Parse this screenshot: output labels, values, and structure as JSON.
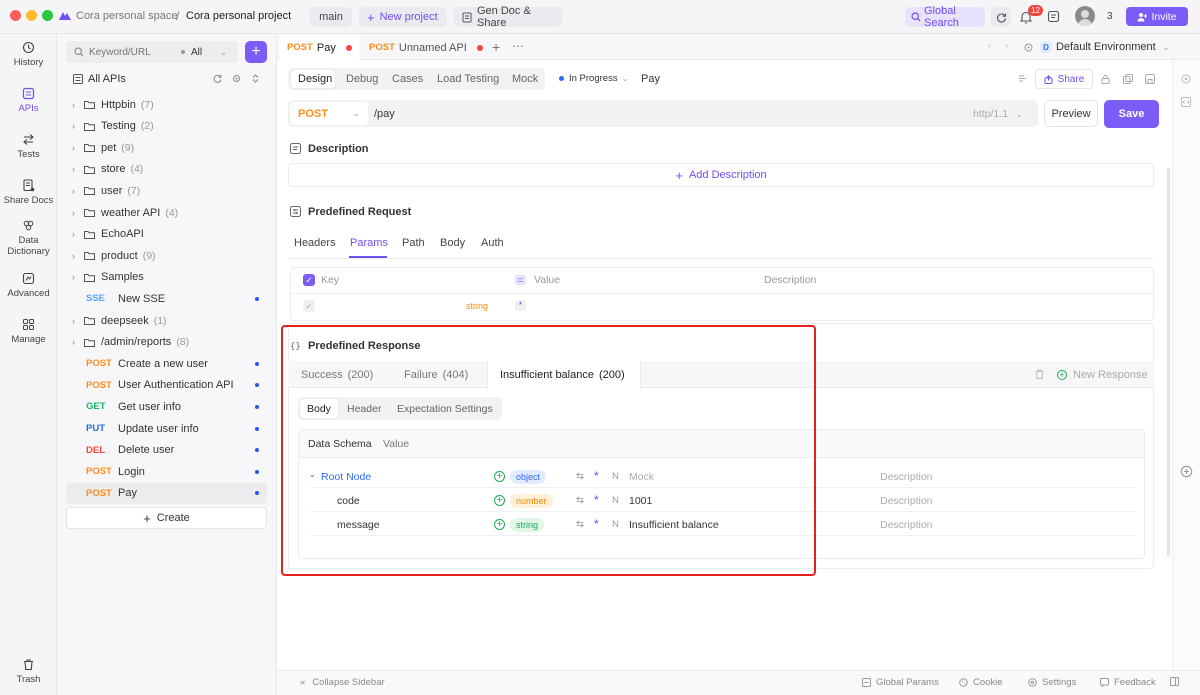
{
  "titlebar": {
    "space": "Cora personal space",
    "separator": "/",
    "project": "Cora personal project",
    "branch": "main",
    "new_project": "New project",
    "gen_doc": "Gen Doc & Share",
    "global_search": "Global Search",
    "notif_count": "12",
    "members_count": "3",
    "invite": "Invite"
  },
  "leftnav": [
    {
      "label": "History",
      "icon": "history-icon"
    },
    {
      "label": "APIs",
      "icon": "apis-icon"
    },
    {
      "label": "Tests",
      "icon": "tests-icon"
    },
    {
      "label": "Share Docs",
      "icon": "share-docs-icon"
    },
    {
      "label": "Data Dictionary",
      "icon": "data-dictionary-icon"
    },
    {
      "label": "Advanced",
      "icon": "advanced-icon"
    },
    {
      "label": "Manage",
      "icon": "manage-icon"
    },
    {
      "label": "Trash",
      "icon": "trash-icon"
    }
  ],
  "sidebar": {
    "search_placeholder": "Keyword/URL",
    "filter": "All",
    "all_apis": "All APIs",
    "items": [
      {
        "kind": "folder",
        "label": "Httpbin",
        "count": "(7)"
      },
      {
        "kind": "folder",
        "label": "Testing",
        "count": "(2)"
      },
      {
        "kind": "folder",
        "label": "pet",
        "count": "(9)"
      },
      {
        "kind": "folder",
        "label": "store",
        "count": "(4)"
      },
      {
        "kind": "folder",
        "label": "user",
        "count": "(7)"
      },
      {
        "kind": "folder",
        "label": "weather API",
        "count": "(4)"
      },
      {
        "kind": "folder",
        "label": "EchoAPI",
        "count": ""
      },
      {
        "kind": "folder",
        "label": "product",
        "count": "(9)"
      },
      {
        "kind": "folder",
        "label": "Samples",
        "count": ""
      },
      {
        "kind": "api",
        "method": "SSE",
        "label": "New SSE"
      },
      {
        "kind": "folder",
        "label": "deepseek",
        "count": "(1)"
      },
      {
        "kind": "folder",
        "label": "/admin/reports",
        "count": "(8)"
      },
      {
        "kind": "api",
        "method": "POST",
        "label": "Create a new user"
      },
      {
        "kind": "api",
        "method": "POST",
        "label": "User Authentication API"
      },
      {
        "kind": "api",
        "method": "GET",
        "label": "Get user info"
      },
      {
        "kind": "api",
        "method": "PUT",
        "label": "Update user info"
      },
      {
        "kind": "api",
        "method": "DEL",
        "label": "Delete user"
      },
      {
        "kind": "api",
        "method": "POST",
        "label": "Login"
      },
      {
        "kind": "api",
        "method": "POST",
        "label": "Pay"
      }
    ],
    "create": "Create"
  },
  "tabs": [
    {
      "method": "POST",
      "name": "Pay"
    },
    {
      "method": "POST",
      "name": "Unnamed API"
    }
  ],
  "environment": {
    "badge": "D",
    "name": "Default Environment"
  },
  "subtabs": [
    "Design",
    "Debug",
    "Cases",
    "Load Testing",
    "Mock"
  ],
  "status": "In Progress",
  "api_name": "Pay",
  "share": "Share",
  "request": {
    "method": "POST",
    "url": "/pay",
    "protocol": "http/1.1",
    "preview": "Preview",
    "save": "Save"
  },
  "description": {
    "title": "Description",
    "add": "Add Description"
  },
  "predefined_request": {
    "title": "Predefined Request",
    "tabs": [
      "Headers",
      "Params",
      "Path",
      "Body",
      "Auth"
    ],
    "columns": {
      "key": "Key",
      "value": "Value",
      "description": "Description"
    },
    "row_type": "string"
  },
  "predefined_response": {
    "title": "Predefined Response",
    "tabs": [
      {
        "label": "Success",
        "code": "(200)"
      },
      {
        "label": "Failure",
        "code": "(404)"
      },
      {
        "label": "Insufficient balance",
        "code": "(200)"
      }
    ],
    "new_response": "New Response",
    "inner_tabs": [
      "Body",
      "Header",
      "Expectation Settings"
    ],
    "schema_tabs": [
      "Data Schema",
      "Value"
    ],
    "rows": [
      {
        "name": "Root Node",
        "type": "object",
        "mock": "Mock",
        "description": "Description"
      },
      {
        "name": "code",
        "type": "number",
        "mock": "1001",
        "description": "Description"
      },
      {
        "name": "message",
        "type": "string",
        "mock": "Insufficient balance",
        "description": "Description"
      }
    ]
  },
  "bottom": {
    "collapse": "Collapse Sidebar",
    "global_params": "Global Params",
    "cookie": "Cookie",
    "settings": "Settings",
    "feedback": "Feedback"
  },
  "colors": {
    "accent": "#7c5cf6",
    "highlight_border": "#e5211d",
    "post": "#ff8c1a",
    "get": "#18b566",
    "put": "#2468f2",
    "delete": "#f2453d"
  }
}
